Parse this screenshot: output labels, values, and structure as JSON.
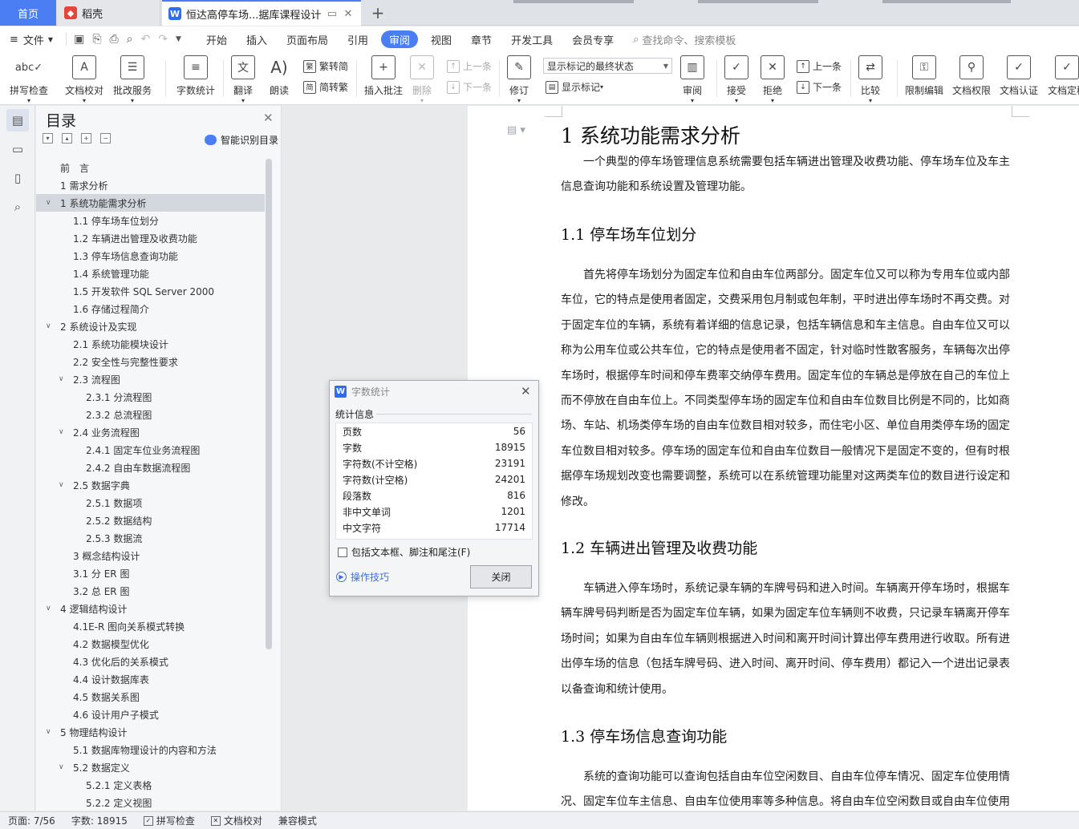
{
  "titlebar": {
    "tabs": [
      {
        "label": "首页"
      },
      {
        "label": "稻壳"
      },
      {
        "label": "恒达高停车场...据库课程设计"
      }
    ]
  },
  "menubar": {
    "file": "文件",
    "items": [
      "开始",
      "插入",
      "页面布局",
      "引用",
      "审阅",
      "视图",
      "章节",
      "开发工具",
      "会员专享"
    ],
    "active": "审阅",
    "search_placeholder": "查找命令、搜索模板"
  },
  "ribbon": {
    "spellcheck": "拼写检查",
    "doc_proof": "文档校对",
    "batch_service": "批改服务",
    "word_count": "字数统计",
    "translate": "翻译",
    "read_aloud": "朗读",
    "trad_simp": "繁转简",
    "simp_trad": "简转繁",
    "insert_comment": "插入批注",
    "delete": "删除",
    "prev_comment": "上一条",
    "next_comment": "下一条",
    "revise": "修订",
    "markup_mode": "显示标记的最终状态",
    "show_markup": "显示标记",
    "review": "审阅",
    "accept": "接受",
    "reject": "拒绝",
    "prev_change": "上一条",
    "next_change": "下一条",
    "compare": "比较",
    "restrict_edit": "限制编辑",
    "doc_rights": "文档权限",
    "doc_cert": "文档认证",
    "doc_final": "文档定稿"
  },
  "toc": {
    "title": "目录",
    "smart_label": "智能识别目录",
    "items": [
      {
        "text": "前　言",
        "level": 0,
        "arrow": ""
      },
      {
        "text": "1 需求分析",
        "level": 0,
        "arrow": ""
      },
      {
        "text": "1 系统功能需求分析",
        "level": 0,
        "arrow": "v",
        "selected": true
      },
      {
        "text": "1.1 停车场车位划分",
        "level": 1,
        "arrow": ""
      },
      {
        "text": "1.2 车辆进出管理及收费功能",
        "level": 1,
        "arrow": ""
      },
      {
        "text": "1.3 停车场信息查询功能",
        "level": 1,
        "arrow": ""
      },
      {
        "text": "1.4 系统管理功能",
        "level": 1,
        "arrow": ""
      },
      {
        "text": "1.5 开发软件 SQL Server 2000",
        "level": 1,
        "arrow": ""
      },
      {
        "text": "1.6 存储过程简介",
        "level": 1,
        "arrow": ""
      },
      {
        "text": "2 系统设计及实现",
        "level": 0,
        "arrow": "v"
      },
      {
        "text": "2.1 系统功能模块设计",
        "level": 1,
        "arrow": ""
      },
      {
        "text": "2.2 安全性与完整性要求",
        "level": 1,
        "arrow": ""
      },
      {
        "text": "2.3 流程图",
        "level": 1,
        "arrow": "v"
      },
      {
        "text": "2.3.1 分流程图",
        "level": 2,
        "arrow": ""
      },
      {
        "text": "2.3.2 总流程图",
        "level": 2,
        "arrow": ""
      },
      {
        "text": "2.4 业务流程图",
        "level": 1,
        "arrow": "v"
      },
      {
        "text": "2.4.1 固定车位业务流程图",
        "level": 2,
        "arrow": ""
      },
      {
        "text": "2.4.2 自由车数据流程图",
        "level": 2,
        "arrow": ""
      },
      {
        "text": "2.5 数据字典",
        "level": 1,
        "arrow": "v"
      },
      {
        "text": "2.5.1 数据项",
        "level": 2,
        "arrow": ""
      },
      {
        "text": "2.5.2 数据结构",
        "level": 2,
        "arrow": ""
      },
      {
        "text": "2.5.3  数据流",
        "level": 2,
        "arrow": ""
      },
      {
        "text": "3 概念结构设计",
        "level": 1,
        "arrow": ""
      },
      {
        "text": "3.1 分 ER 图",
        "level": 1,
        "arrow": ""
      },
      {
        "text": "3.2  总 ER 图",
        "level": 1,
        "arrow": ""
      },
      {
        "text": "4 逻辑结构设计",
        "level": 0,
        "arrow": "v"
      },
      {
        "text": "4.1E-R 图向关系模式转换",
        "level": 1,
        "arrow": ""
      },
      {
        "text": "4.2 数据模型优化",
        "level": 1,
        "arrow": ""
      },
      {
        "text": "4.3 优化后的关系模式",
        "level": 1,
        "arrow": ""
      },
      {
        "text": "4.4 设计数据库表",
        "level": 1,
        "arrow": ""
      },
      {
        "text": "4.5 数据关系图",
        "level": 1,
        "arrow": ""
      },
      {
        "text": "4.6 设计用户子模式",
        "level": 1,
        "arrow": ""
      },
      {
        "text": "5 物理结构设计",
        "level": 0,
        "arrow": "v"
      },
      {
        "text": "5.1 数据库物理设计的内容和方法",
        "level": 1,
        "arrow": ""
      },
      {
        "text": "5.2 数据定义",
        "level": 1,
        "arrow": "v"
      },
      {
        "text": "5.2.1  定义表格",
        "level": 2,
        "arrow": ""
      },
      {
        "text": "5.2.2  定义视图",
        "level": 2,
        "arrow": ""
      }
    ]
  },
  "doc": {
    "h1": "1 系统功能需求分析",
    "p1": [
      "一个典型的停车场管理信息系统需要包括车辆进出管理及收费功能、停车场车位及车主",
      "信息查询功能和系统设置及管理功能。"
    ],
    "h2_1": "1.1 停车场车位划分",
    "p2": [
      "首先将停车场划分为固定车位和自由车位两部分。固定车位又可以称为专用车位或内部",
      "车位，它的特点是使用者固定，交费采用包月制或包年制，平时进出停车场时不再交费。对",
      "于固定车位的车辆，系统有着详细的信息记录，包括车辆信息和车主信息。自由车位又可以",
      "称为公用车位或公共车位，它的特点是使用者不固定，针对临时性散客服务，车辆每次出停",
      "车场时，根据停车时间和停车费率交纳停车费用。固定车位的车辆总是停放在自己的车位上，",
      "而不停放在自由车位上。不同类型停车场的固定车位和自由车位数目比例是不同的，比如商",
      "场、车站、机场类停车场的自由车位数目相对较多，而住宅小区、单位自用类停车场的固定",
      "车位数目相对较多。停车场的固定车位和自由车位数目一般情况下是固定不变的，但有时根",
      "据停车场规划改变也需要调整，系统可以在系统管理功能里对这两类车位的数目进行设定和",
      "修改。"
    ],
    "h2_2": "1.2 车辆进出管理及收费功能",
    "p3": [
      "车辆进入停车场时，系统记录车辆的车牌号码和进入时间。车辆离开停车场时，根据车",
      "辆车牌号码判断是否为固定车位车辆，如果为固定车位车辆则不收费，只记录车辆离开停车",
      "场时间；如果为自由车位车辆则根据进入时间和离开时间计算出停车费用进行收取。所有进",
      "出停车场的信息（包括车牌号码、进入时间、离开时间、停车费用）都记入一个进出记录表",
      "以备查询和统计使用。"
    ],
    "h2_3": "1.3 停车场信息查询功能",
    "p4": [
      "系统的查询功能可以查询包括自由车位空闲数目、自由车位停车情况、固定车位使用情",
      "况、固定车位车主信息、自由车位使用率等多种信息。将自由车位空闲数目或自由车位使用"
    ]
  },
  "dialog": {
    "title": "字数统计",
    "section": "统计信息",
    "rows": [
      {
        "label": "页数",
        "value": "56"
      },
      {
        "label": "字数",
        "value": "18915"
      },
      {
        "label": "字符数(不计空格)",
        "value": "23191"
      },
      {
        "label": "字符数(计空格)",
        "value": "24201"
      },
      {
        "label": "段落数",
        "value": "816"
      },
      {
        "label": "非中文单词",
        "value": "1201"
      },
      {
        "label": "中文字符",
        "value": "17714"
      }
    ],
    "include_label": "包括文本框、脚注和尾注(F)",
    "tips": "操作技巧",
    "close": "关闭"
  },
  "statusbar": {
    "page": "页面: 7/56",
    "words": "字数: 18915",
    "spell": "拼写检查",
    "proof": "文档校对",
    "compat": "兼容模式"
  },
  "colors": {
    "accent": "#4c7ef3"
  }
}
